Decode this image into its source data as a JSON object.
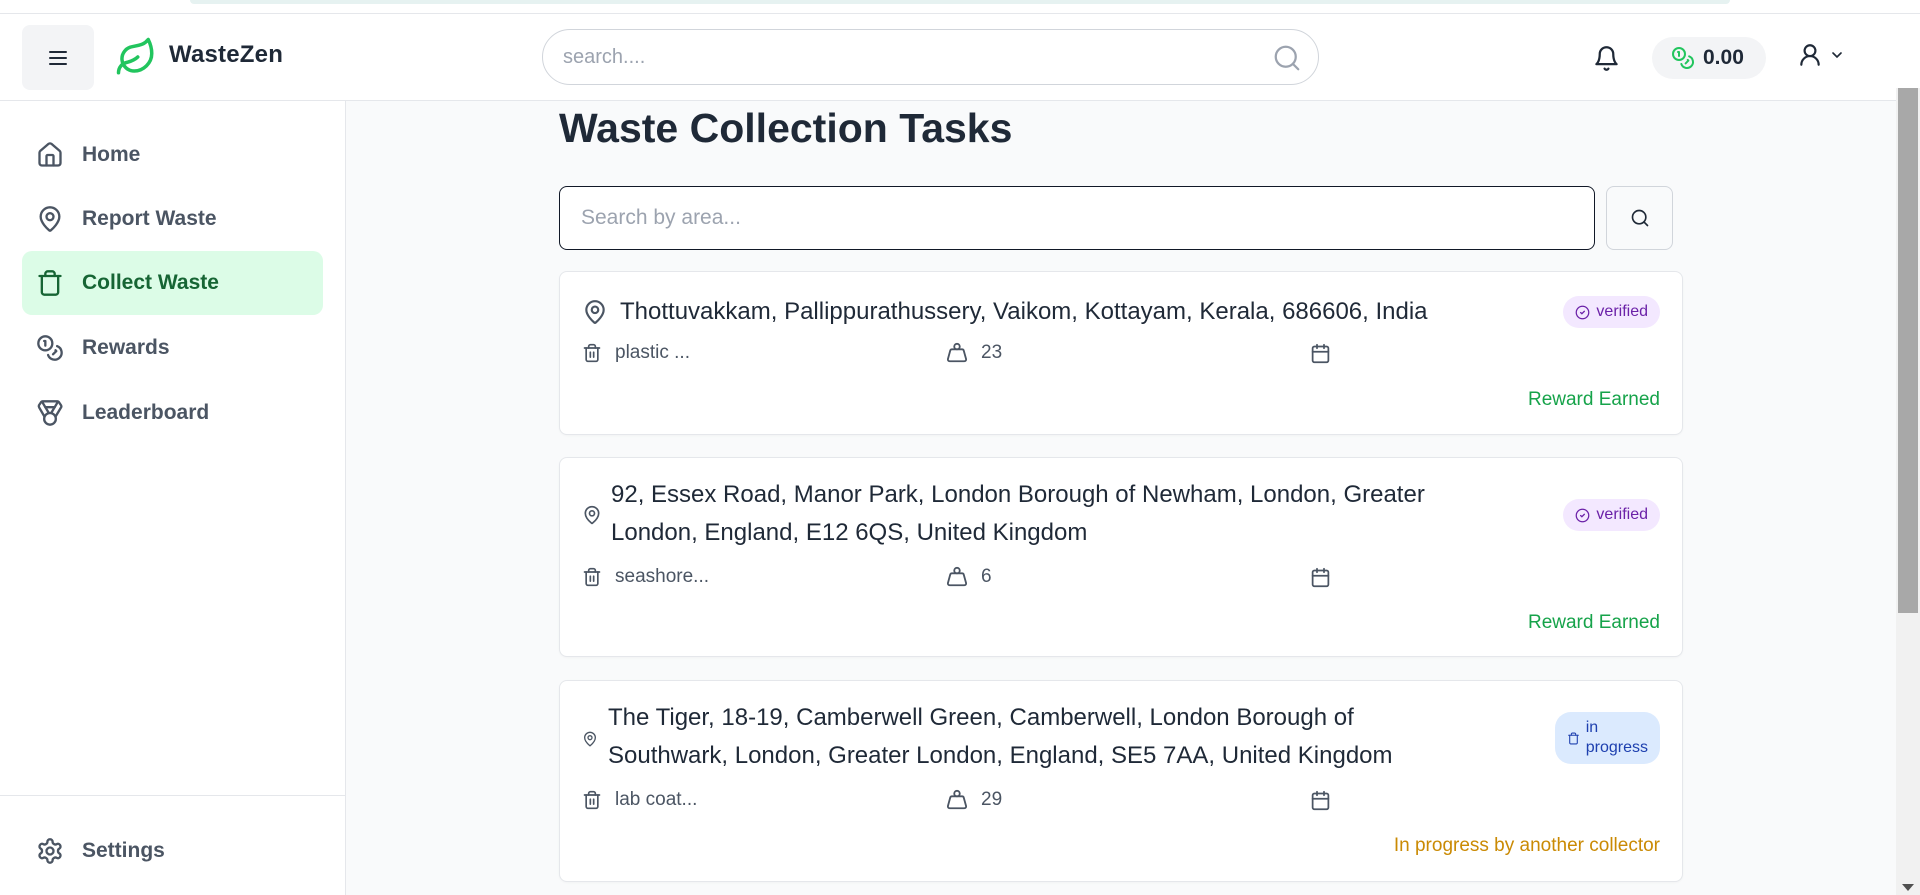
{
  "app": {
    "name": "WasteZen"
  },
  "header": {
    "search_placeholder": "search....",
    "balance": "0.00"
  },
  "sidebar": {
    "items": [
      {
        "label": "Home",
        "icon": "home-icon"
      },
      {
        "label": "Report Waste",
        "icon": "map-pin-icon"
      },
      {
        "label": "Collect Waste",
        "icon": "trash-icon",
        "active": true
      },
      {
        "label": "Rewards",
        "icon": "coins-icon"
      },
      {
        "label": "Leaderboard",
        "icon": "medal-icon"
      }
    ],
    "settings_label": "Settings"
  },
  "main": {
    "title": "Waste Collection Tasks",
    "area_search_placeholder": "Search by area..."
  },
  "tasks": [
    {
      "address": "Thottuvakkam, Pallippurathussery, Vaikom, Kottayam, Kerala, 686606, India",
      "badge": "verified",
      "waste_type": "plastic ...",
      "amount": "23",
      "status": "Reward Earned"
    },
    {
      "address_lines": [
        "92, Essex Road, Manor Park, London Borough of Newham, London, Greater",
        "London, England, E12 6QS, United Kingdom"
      ],
      "badge": "verified",
      "waste_type": "seashore...",
      "amount": "6",
      "status": "Reward Earned"
    },
    {
      "address_lines": [
        "The Tiger, 18-19, Camberwell Green, Camberwell, London Borough of",
        "Southwark, London, Greater London, England, SE5 7AA, United Kingdom"
      ],
      "badge_lines": [
        "in",
        "progress"
      ],
      "waste_type": "lab coat...",
      "amount": "29",
      "status": "In progress by another collector"
    }
  ],
  "colors": {
    "accent": "#22c55e",
    "active_bg": "#dcfce7",
    "verified_bg": "#f3e8ff",
    "verified_fg": "#6b21a8",
    "progress_bg": "#dbeafe",
    "earned": "#16a34a",
    "inprogress": "#ca8a04"
  }
}
